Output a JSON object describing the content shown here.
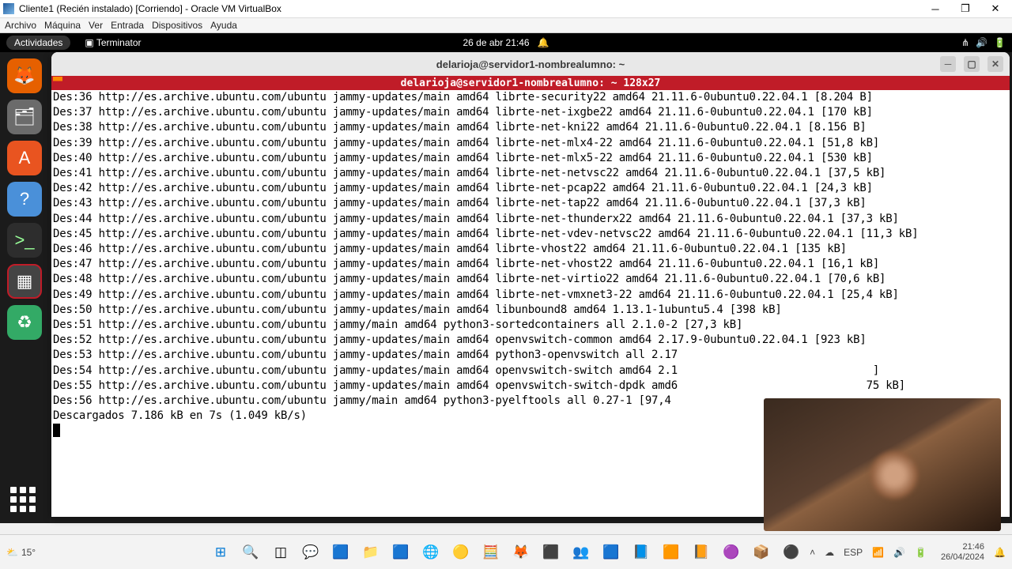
{
  "vb": {
    "title": "Cliente1 (Recién instalado) [Corriendo] - Oracle VM VirtualBox",
    "menu": [
      "Archivo",
      "Máquina",
      "Ver",
      "Entrada",
      "Dispositivos",
      "Ayuda"
    ]
  },
  "gnome": {
    "activities": "Actividades",
    "app": "Terminator",
    "date": "26 de abr  21:46"
  },
  "term": {
    "title": "delarioja@servidor1-nombrealumno: ~",
    "redbar": "delarioja@servidor1-nombrealumno: ~  128x27",
    "lines": [
      "Des:36 http://es.archive.ubuntu.com/ubuntu jammy-updates/main amd64 librte-security22 amd64 21.11.6-0ubuntu0.22.04.1 [8.204 B]",
      "Des:37 http://es.archive.ubuntu.com/ubuntu jammy-updates/main amd64 librte-net-ixgbe22 amd64 21.11.6-0ubuntu0.22.04.1 [170 kB]",
      "Des:38 http://es.archive.ubuntu.com/ubuntu jammy-updates/main amd64 librte-net-kni22 amd64 21.11.6-0ubuntu0.22.04.1 [8.156 B]",
      "Des:39 http://es.archive.ubuntu.com/ubuntu jammy-updates/main amd64 librte-net-mlx4-22 amd64 21.11.6-0ubuntu0.22.04.1 [51,8 kB]",
      "Des:40 http://es.archive.ubuntu.com/ubuntu jammy-updates/main amd64 librte-net-mlx5-22 amd64 21.11.6-0ubuntu0.22.04.1 [530 kB]",
      "Des:41 http://es.archive.ubuntu.com/ubuntu jammy-updates/main amd64 librte-net-netvsc22 amd64 21.11.6-0ubuntu0.22.04.1 [37,5 kB]",
      "Des:42 http://es.archive.ubuntu.com/ubuntu jammy-updates/main amd64 librte-net-pcap22 amd64 21.11.6-0ubuntu0.22.04.1 [24,3 kB]",
      "Des:43 http://es.archive.ubuntu.com/ubuntu jammy-updates/main amd64 librte-net-tap22 amd64 21.11.6-0ubuntu0.22.04.1 [37,3 kB]",
      "Des:44 http://es.archive.ubuntu.com/ubuntu jammy-updates/main amd64 librte-net-thunderx22 amd64 21.11.6-0ubuntu0.22.04.1 [37,3 kB]",
      "Des:45 http://es.archive.ubuntu.com/ubuntu jammy-updates/main amd64 librte-net-vdev-netvsc22 amd64 21.11.6-0ubuntu0.22.04.1 [11,3 kB]",
      "Des:46 http://es.archive.ubuntu.com/ubuntu jammy-updates/main amd64 librte-vhost22 amd64 21.11.6-0ubuntu0.22.04.1 [135 kB]",
      "Des:47 http://es.archive.ubuntu.com/ubuntu jammy-updates/main amd64 librte-net-vhost22 amd64 21.11.6-0ubuntu0.22.04.1 [16,1 kB]",
      "Des:48 http://es.archive.ubuntu.com/ubuntu jammy-updates/main amd64 librte-net-virtio22 amd64 21.11.6-0ubuntu0.22.04.1 [70,6 kB]",
      "Des:49 http://es.archive.ubuntu.com/ubuntu jammy-updates/main amd64 librte-net-vmxnet3-22 amd64 21.11.6-0ubuntu0.22.04.1 [25,4 kB]",
      "Des:50 http://es.archive.ubuntu.com/ubuntu jammy-updates/main amd64 libunbound8 amd64 1.13.1-1ubuntu5.4 [398 kB]",
      "Des:51 http://es.archive.ubuntu.com/ubuntu jammy/main amd64 python3-sortedcontainers all 2.1.0-2 [27,3 kB]",
      "Des:52 http://es.archive.ubuntu.com/ubuntu jammy-updates/main amd64 openvswitch-common amd64 2.17.9-0ubuntu0.22.04.1 [923 kB]",
      "Des:53 http://es.archive.ubuntu.com/ubuntu jammy-updates/main amd64 python3-openvswitch all 2.17",
      "Des:54 http://es.archive.ubuntu.com/ubuntu jammy-updates/main amd64 openvswitch-switch amd64 2.1                              ]",
      "Des:55 http://es.archive.ubuntu.com/ubuntu jammy-updates/main amd64 openvswitch-switch-dpdk amd6                             75 kB]",
      "Des:56 http://es.archive.ubuntu.com/ubuntu jammy/main amd64 python3-pyelftools all 0.27-1 [97,4",
      "Descargados 7.186 kB en 7s (1.049 kB/s)"
    ]
  },
  "win": {
    "weather": "15°",
    "time": "21:46",
    "date": "26/04/2024"
  }
}
